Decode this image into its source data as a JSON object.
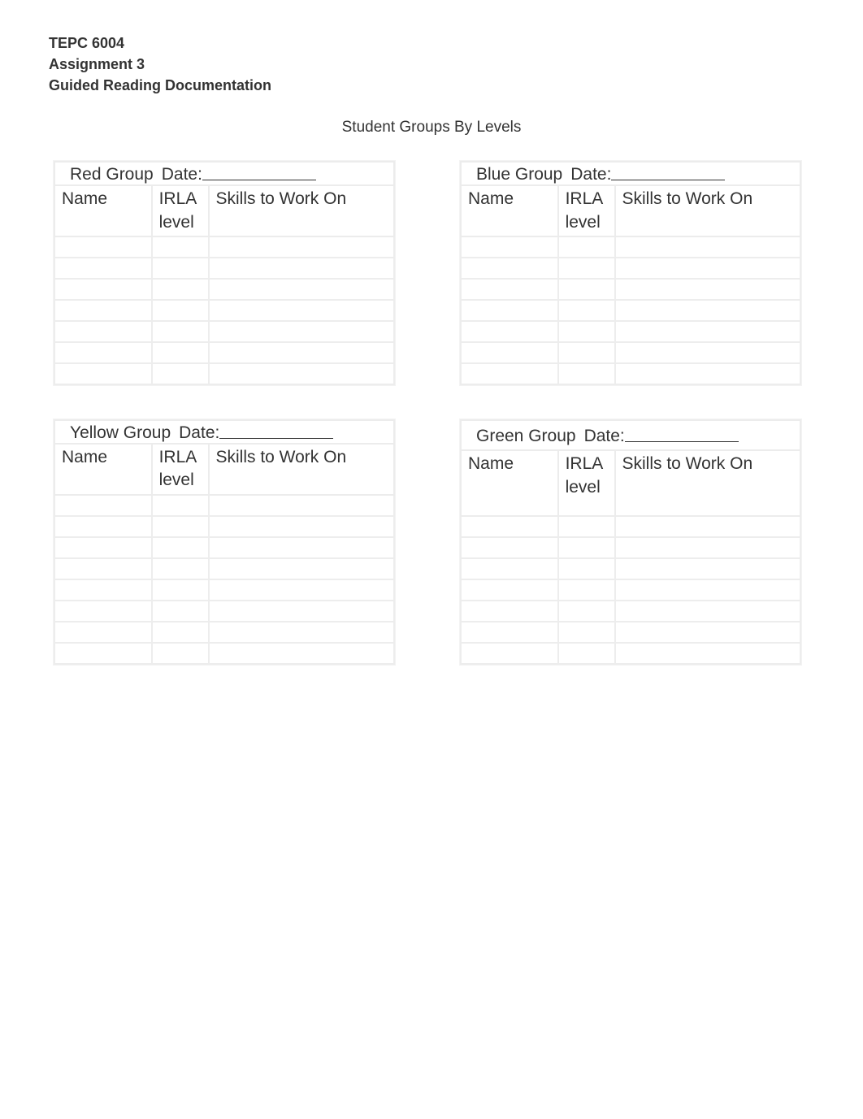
{
  "header": {
    "course": "TEPC 6004",
    "assignment": "Assignment 3",
    "doc_title": "Guided Reading Documentation"
  },
  "page_title": "Student Groups By Levels",
  "columns": {
    "name": "Name",
    "irla": "IRLA level",
    "skills": "Skills to Work On"
  },
  "date_label": "Date:",
  "groups": [
    {
      "label": "Red Group",
      "rows": 7
    },
    {
      "label": "Blue Group",
      "rows": 7
    },
    {
      "label": "Yellow Group",
      "rows": 8
    },
    {
      "label": "Green Group",
      "rows": 7
    }
  ]
}
